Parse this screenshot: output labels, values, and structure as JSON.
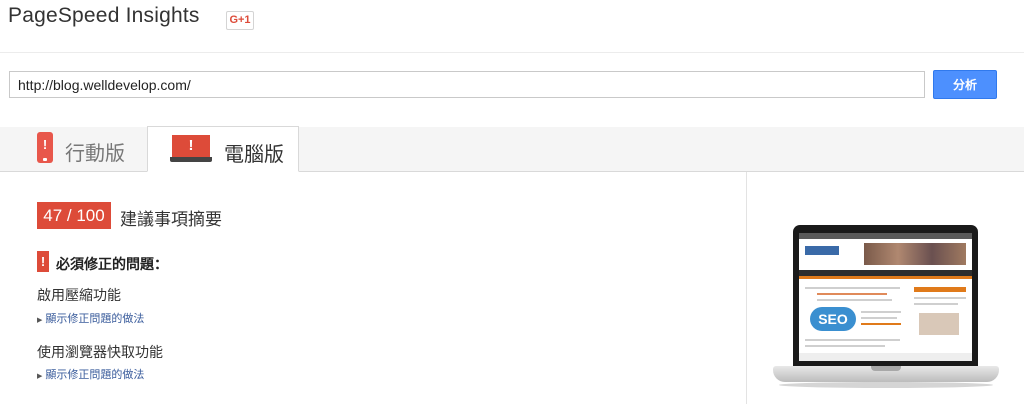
{
  "header": {
    "title": "PageSpeed Insights",
    "gplus_label": "G+1"
  },
  "search": {
    "url_value": "http://blog.welldevelop.com/",
    "analyze_label": "分析"
  },
  "tabs": [
    {
      "label": "行動版",
      "icon": "mobile-phone-icon",
      "active": false
    },
    {
      "label": "電腦版",
      "icon": "desktop-monitor-icon",
      "active": true
    }
  ],
  "summary": {
    "score": "47 / 100",
    "caption": "建議事項摘要",
    "score_color": "#dd4b39"
  },
  "must_fix": {
    "icon": "!",
    "heading": "必須修正的問題：",
    "rules": [
      {
        "title": "啟用壓縮功能",
        "link": "顯示修正問題的做法"
      },
      {
        "title": "使用瀏覽器快取功能",
        "link": "顯示修正問題的做法"
      }
    ]
  },
  "preview": {
    "seo_text": "SEO"
  },
  "colors": {
    "accent": "#4d90fe",
    "error": "#dd4b39",
    "link": "#3a5c9c"
  }
}
